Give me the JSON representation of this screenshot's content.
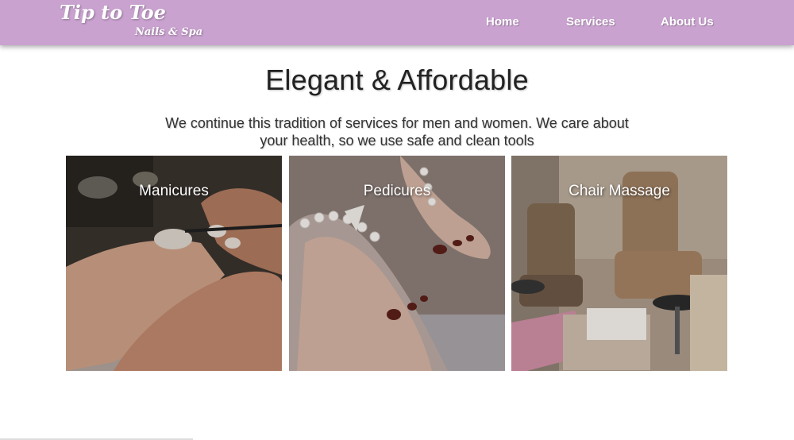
{
  "brand": {
    "title": "Tip to Toe",
    "subtitle": "Nails & Spa"
  },
  "nav": {
    "items": [
      {
        "label": "Home"
      },
      {
        "label": "Services"
      },
      {
        "label": "About Us"
      }
    ]
  },
  "hero": {
    "headline": "Elegant & Affordable",
    "intro": "We continue this tradition of services for men and women. We care about your health, so we use safe and clean tools"
  },
  "services": {
    "cards": [
      {
        "title": "Manicures",
        "image_icon": "manicure-photo"
      },
      {
        "title": "Pedicures",
        "image_icon": "pedicure-photo"
      },
      {
        "title": "Chair Massage",
        "image_icon": "massage-chair-photo"
      }
    ]
  },
  "colors": {
    "navbar": "#c9a2cf",
    "text": "#222222",
    "nav_text": "#ffffff"
  }
}
